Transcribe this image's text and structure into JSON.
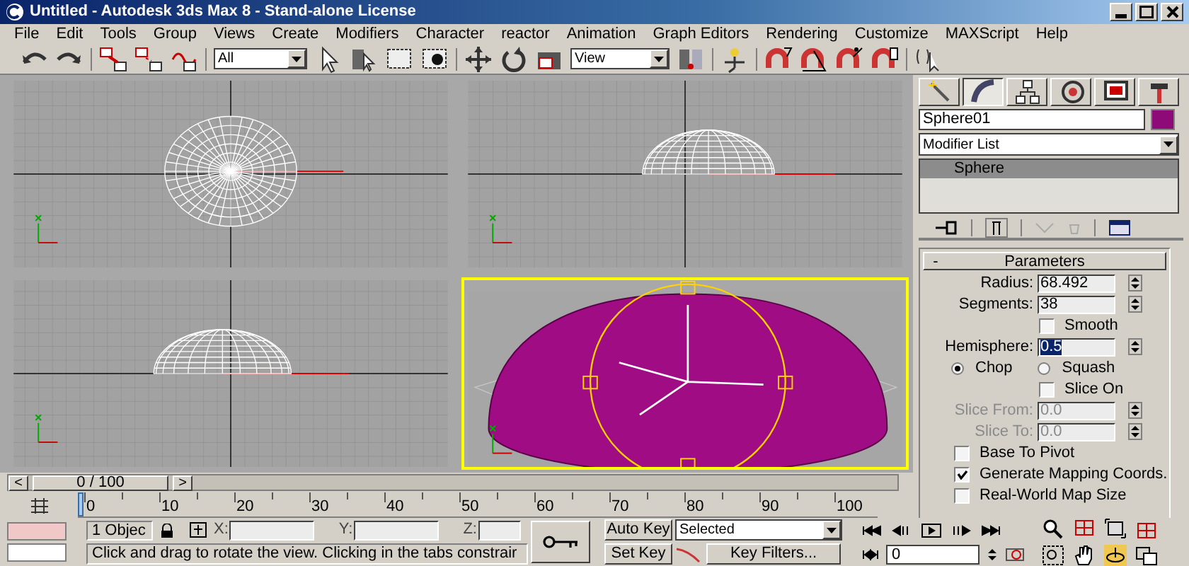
{
  "window": {
    "title": "Untitled - Autodesk 3ds Max 8  - Stand-alone License"
  },
  "menu": [
    "File",
    "Edit",
    "Tools",
    "Group",
    "Views",
    "Create",
    "Modifiers",
    "Character",
    "reactor",
    "Animation",
    "Graph Editors",
    "Rendering",
    "Customize",
    "MAXScript",
    "Help"
  ],
  "toolbar": {
    "selection_filter": "All",
    "coordinate_system": "View"
  },
  "viewports": [
    {
      "kind": "wire-sphere",
      "selected": false
    },
    {
      "kind": "wire-dome",
      "selected": false
    },
    {
      "kind": "wire-dome",
      "selected": false
    },
    {
      "kind": "shaded-dome",
      "selected": true
    }
  ],
  "command_panel": {
    "tabs": [
      {
        "selected": false
      },
      {
        "selected": true
      },
      {
        "selected": false
      },
      {
        "selected": false
      },
      {
        "selected": false
      },
      {
        "selected": false
      }
    ],
    "object_name": "Sphere01",
    "modifier_list": "Modifier List",
    "stack": [
      {
        "label": "Sphere",
        "selected": true
      }
    ],
    "rollout": {
      "toggle": "-",
      "title": "Parameters",
      "controls": [
        {
          "kind": "spinner",
          "label": "Radius:",
          "value": "68.492",
          "disabled": false,
          "highlighted": false
        },
        {
          "kind": "spinner",
          "label": "Segments:",
          "value": "38",
          "disabled": false,
          "highlighted": false
        },
        {
          "kind": "sub-checkbox",
          "label": "Smooth",
          "checked": false
        },
        {
          "kind": "spinner",
          "label": "Hemisphere:",
          "value": "0.5",
          "disabled": false,
          "highlighted": true
        },
        {
          "kind": "radios",
          "options": [
            {
              "label": "Chop",
              "selected": true
            },
            {
              "label": "Squash",
              "selected": false
            }
          ]
        },
        {
          "kind": "sub-checkbox",
          "label": "Slice On",
          "checked": false
        },
        {
          "kind": "spinner",
          "label": "Slice From:",
          "value": "0.0",
          "disabled": true,
          "highlighted": false
        },
        {
          "kind": "spinner",
          "label": "Slice To:",
          "value": "0.0",
          "disabled": true,
          "highlighted": false
        },
        {
          "kind": "checkbox",
          "label": "Base To Pivot",
          "checked": false
        },
        {
          "kind": "checkbox",
          "label": "Generate Mapping Coords.",
          "checked": true
        },
        {
          "kind": "checkbox",
          "label": "Real-World Map Size",
          "checked": false
        }
      ]
    }
  },
  "timeline": {
    "prev": "<",
    "position": "0 / 100",
    "next": ">"
  },
  "ruler": [
    "0",
    "10",
    "20",
    "30",
    "40",
    "50",
    "60",
    "70",
    "80",
    "90",
    "100"
  ],
  "status": {
    "selection": "1 Objec",
    "x_label": "X:",
    "y_label": "Y:",
    "z_label": "Z:",
    "prompt": "Click and drag to rotate the view.  Clicking in the tabs constrair"
  },
  "animation": {
    "auto_key": "Auto Key",
    "set_key": "Set Key",
    "key_mode": "Selected",
    "key_filters": "Key Filters...",
    "frame": "0"
  }
}
